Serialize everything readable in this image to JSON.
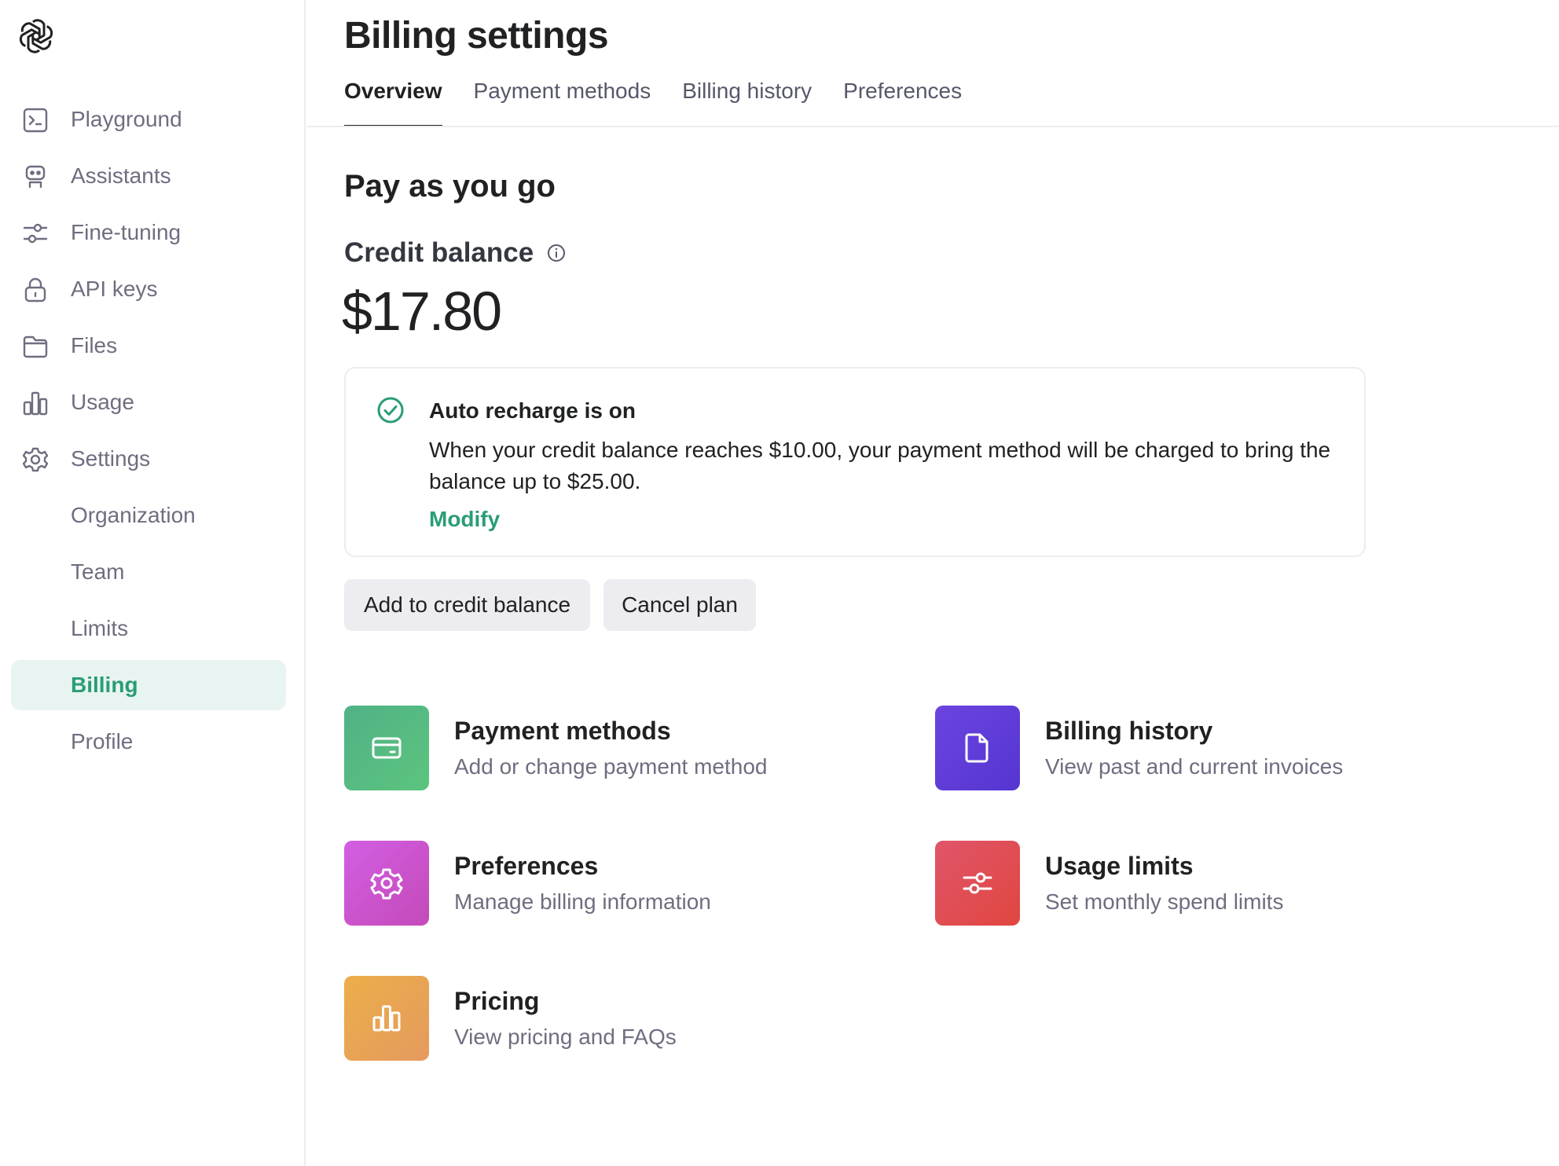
{
  "sidebar": {
    "items": [
      {
        "label": "Playground",
        "icon": "terminal-icon"
      },
      {
        "label": "Assistants",
        "icon": "robot-icon"
      },
      {
        "label": "Fine-tuning",
        "icon": "sliders-icon"
      },
      {
        "label": "API keys",
        "icon": "lock-icon"
      },
      {
        "label": "Files",
        "icon": "folder-icon"
      },
      {
        "label": "Usage",
        "icon": "bar-chart-icon"
      },
      {
        "label": "Settings",
        "icon": "gear-icon"
      },
      {
        "label": "Organization"
      },
      {
        "label": "Team"
      },
      {
        "label": "Limits"
      },
      {
        "label": "Billing",
        "active": true
      },
      {
        "label": "Profile"
      }
    ]
  },
  "header": {
    "title": "Billing settings",
    "tabs": [
      {
        "label": "Overview",
        "active": true
      },
      {
        "label": "Payment methods"
      },
      {
        "label": "Billing history"
      },
      {
        "label": "Preferences"
      }
    ]
  },
  "plan": {
    "title": "Pay as you go",
    "credit_label": "Credit balance",
    "credit_amount": "$17.80"
  },
  "recharge": {
    "title": "Auto recharge is on",
    "text": "When your credit balance reaches $10.00, your payment method will be charged to bring the balance up to $25.00.",
    "modify_label": "Modify"
  },
  "actions": {
    "add_label": "Add to credit balance",
    "cancel_label": "Cancel plan"
  },
  "cards": [
    {
      "title": "Payment methods",
      "desc": "Add or change payment method",
      "icon": "credit-card-icon"
    },
    {
      "title": "Billing history",
      "desc": "View past and current invoices",
      "icon": "document-icon"
    },
    {
      "title": "Preferences",
      "desc": "Manage billing information",
      "icon": "gear-icon"
    },
    {
      "title": "Usage limits",
      "desc": "Set monthly spend limits",
      "icon": "sliders-icon"
    },
    {
      "title": "Pricing",
      "desc": "View pricing and FAQs",
      "icon": "bar-chart-icon"
    }
  ],
  "colors": {
    "accent": "#2a9d74",
    "active_bg": "#e8f4f1"
  }
}
